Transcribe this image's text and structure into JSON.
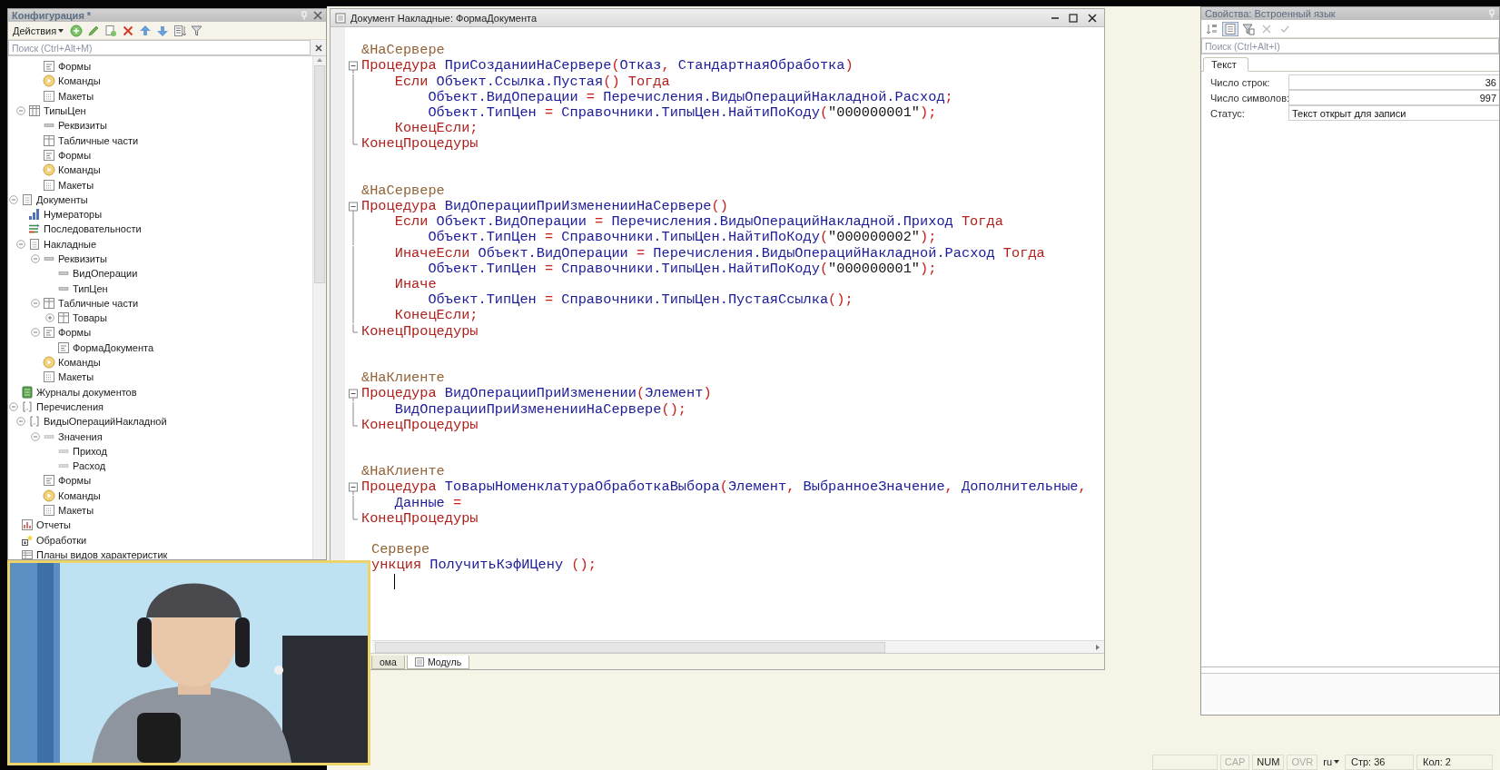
{
  "config_panel": {
    "title": "Конфигурация *",
    "actions": "Действия",
    "search": {
      "placeholder": "Поиск (Ctrl+Alt+M)"
    },
    "tree": [
      {
        "children": [
          {
            "children": [
              {
                "label": "Формы",
                "kind": "form"
              },
              {
                "label": "Команды",
                "kind": "command"
              },
              {
                "label": "Макеты",
                "kind": "layout"
              }
            ]
          },
          {
            "label": "ТипыЦен",
            "kind": "catalog",
            "expanded": true,
            "children": [
              {
                "label": "Реквизиты",
                "kind": "attribute"
              },
              {
                "label": "Табличные части",
                "kind": "tablepart"
              },
              {
                "label": "Формы",
                "kind": "form"
              },
              {
                "label": "Команды",
                "kind": "command"
              },
              {
                "label": "Макеты",
                "kind": "layout"
              }
            ]
          }
        ]
      },
      {
        "label": "Документы",
        "kind": "document",
        "expanded": true,
        "children": [
          {
            "label": "Нумераторы",
            "kind": "numerator"
          },
          {
            "label": "Последовательности",
            "kind": "sequence"
          },
          {
            "label": "Накладные",
            "kind": "document",
            "expanded": true,
            "children": [
              {
                "label": "Реквизиты",
                "kind": "attribute",
                "expanded": true,
                "children": [
                  {
                    "label": "ВидОперации",
                    "kind": "attribute"
                  },
                  {
                    "label": "ТипЦен",
                    "kind": "attribute"
                  }
                ]
              },
              {
                "label": "Табличные части",
                "kind": "tablepart",
                "expanded": true,
                "children": [
                  {
                    "label": "Товары",
                    "kind": "tablepart",
                    "expanded": false
                  }
                ]
              },
              {
                "label": "Формы",
                "kind": "form",
                "expanded": true,
                "children": [
                  {
                    "label": "ФормаДокумента",
                    "kind": "form"
                  }
                ]
              },
              {
                "label": "Команды",
                "kind": "command"
              },
              {
                "label": "Макеты",
                "kind": "layout"
              }
            ]
          }
        ]
      },
      {
        "label": "Журналы документов",
        "kind": "journal"
      },
      {
        "label": "Перечисления",
        "kind": "enum",
        "expanded": true,
        "children": [
          {
            "label": "ВидыОперацийНакладной",
            "kind": "enum",
            "expanded": true,
            "children": [
              {
                "label": "Значения",
                "kind": "value",
                "expanded": true,
                "children": [
                  {
                    "label": "Приход",
                    "kind": "value"
                  },
                  {
                    "label": "Расход",
                    "kind": "value"
                  }
                ]
              },
              {
                "label": "Формы",
                "kind": "form"
              },
              {
                "label": "Команды",
                "kind": "command"
              },
              {
                "label": "Макеты",
                "kind": "layout"
              }
            ]
          }
        ]
      },
      {
        "label": "Отчеты",
        "kind": "report"
      },
      {
        "label": "Обработки",
        "kind": "processing"
      },
      {
        "label": "Планы видов характеристик",
        "kind": "charplan"
      }
    ]
  },
  "editor": {
    "title": "Документ Накладные: ФормаДокумента",
    "lines": [
      {
        "kind": "blank"
      },
      {
        "kind": "plain",
        "tokens": [
          {
            "kind": "directive",
            "text": "&НаСервере"
          }
        ]
      },
      {
        "kind": "opener",
        "tokens": [
          {
            "kind": "keyword",
            "text": "Процедура"
          },
          {
            "kind": "name",
            "text": " ПриСозданииНаСервере"
          },
          {
            "kind": "punct",
            "text": "("
          },
          {
            "kind": "name",
            "text": "Отказ"
          },
          {
            "kind": "punct",
            "text": ","
          },
          {
            "kind": "name",
            "text": " СтандартнаяОбработка"
          },
          {
            "kind": "punct",
            "text": ")"
          }
        ]
      },
      {
        "kind": "inner",
        "tokens": [
          {
            "kind": "keyword",
            "text": "    Если"
          },
          {
            "kind": "name",
            "text": " Объект.Ссылка.Пустая"
          },
          {
            "kind": "punct",
            "text": "()"
          },
          {
            "kind": "keyword",
            "text": " Тогда"
          }
        ]
      },
      {
        "kind": "inner",
        "tokens": [
          {
            "kind": "name",
            "text": "        Объект.ВидОперации "
          },
          {
            "kind": "punct",
            "text": "="
          },
          {
            "kind": "name",
            "text": " Перечисления.ВидыОперацийНакладной.Расход"
          },
          {
            "kind": "punct",
            "text": ";"
          }
        ]
      },
      {
        "kind": "inner",
        "tokens": [
          {
            "kind": "name",
            "text": "        Объект.ТипЦен "
          },
          {
            "kind": "punct",
            "text": "="
          },
          {
            "kind": "name",
            "text": " Справочники.ТипыЦен.НайтиПоКоду"
          },
          {
            "kind": "punct",
            "text": "("
          },
          {
            "kind": "string",
            "text": "\"000000001\""
          },
          {
            "kind": "punct",
            "text": ");"
          }
        ]
      },
      {
        "kind": "inner",
        "tokens": [
          {
            "kind": "keyword",
            "text": "    КонецЕсли"
          },
          {
            "kind": "punct",
            "text": ";"
          }
        ]
      },
      {
        "kind": "closer",
        "tokens": [
          {
            "kind": "keyword",
            "text": "КонецПроцедуры"
          }
        ]
      },
      {
        "kind": "blank"
      },
      {
        "kind": "blank"
      },
      {
        "kind": "plain",
        "tokens": [
          {
            "kind": "directive",
            "text": "&НаСервере"
          }
        ]
      },
      {
        "kind": "opener",
        "tokens": [
          {
            "kind": "keyword",
            "text": "Процедура"
          },
          {
            "kind": "name",
            "text": " ВидОперацииПриИзмененииНаСервере"
          },
          {
            "kind": "punct",
            "text": "()"
          }
        ]
      },
      {
        "kind": "inner",
        "tokens": [
          {
            "kind": "keyword",
            "text": "    Если"
          },
          {
            "kind": "name",
            "text": " Объект.ВидОперации "
          },
          {
            "kind": "punct",
            "text": "="
          },
          {
            "kind": "name",
            "text": " Перечисления.ВидыОперацийНакладной.Приход"
          },
          {
            "kind": "keyword",
            "text": " Тогда"
          }
        ]
      },
      {
        "kind": "inner",
        "tokens": [
          {
            "kind": "name",
            "text": "        Объект.ТипЦен "
          },
          {
            "kind": "punct",
            "text": "="
          },
          {
            "kind": "name",
            "text": " Справочники.ТипыЦен.НайтиПоКоду"
          },
          {
            "kind": "punct",
            "text": "("
          },
          {
            "kind": "string",
            "text": "\"000000002\""
          },
          {
            "kind": "punct",
            "text": ");"
          }
        ]
      },
      {
        "kind": "inner",
        "tokens": [
          {
            "kind": "keyword",
            "text": "    ИначеЕсли"
          },
          {
            "kind": "name",
            "text": " Объект.ВидОперации "
          },
          {
            "kind": "punct",
            "text": "="
          },
          {
            "kind": "name",
            "text": " Перечисления.ВидыОперацийНакладной.Расход"
          },
          {
            "kind": "keyword",
            "text": " Тогда"
          }
        ]
      },
      {
        "kind": "inner",
        "tokens": [
          {
            "kind": "name",
            "text": "        Объект.ТипЦен "
          },
          {
            "kind": "punct",
            "text": "="
          },
          {
            "kind": "name",
            "text": " Справочники.ТипыЦен.НайтиПоКоду"
          },
          {
            "kind": "punct",
            "text": "("
          },
          {
            "kind": "string",
            "text": "\"000000001\""
          },
          {
            "kind": "punct",
            "text": ");"
          }
        ]
      },
      {
        "kind": "inner",
        "tokens": [
          {
            "kind": "keyword",
            "text": "    Иначе"
          }
        ]
      },
      {
        "kind": "inner",
        "tokens": [
          {
            "kind": "name",
            "text": "        Объект.ТипЦен "
          },
          {
            "kind": "punct",
            "text": "="
          },
          {
            "kind": "name",
            "text": " Справочники.ТипыЦен.ПустаяСсылка"
          },
          {
            "kind": "punct",
            "text": "();"
          }
        ]
      },
      {
        "kind": "inner",
        "tokens": [
          {
            "kind": "keyword",
            "text": "    КонецЕсли"
          },
          {
            "kind": "punct",
            "text": ";"
          }
        ]
      },
      {
        "kind": "closer",
        "tokens": [
          {
            "kind": "keyword",
            "text": "КонецПроцедуры"
          }
        ]
      },
      {
        "kind": "blank"
      },
      {
        "kind": "blank"
      },
      {
        "kind": "plain",
        "tokens": [
          {
            "kind": "directive",
            "text": "&НаКлиенте"
          }
        ]
      },
      {
        "kind": "opener",
        "tokens": [
          {
            "kind": "keyword",
            "text": "Процедура"
          },
          {
            "kind": "name",
            "text": " ВидОперацииПриИзменении"
          },
          {
            "kind": "punct",
            "text": "("
          },
          {
            "kind": "name",
            "text": "Элемент"
          },
          {
            "kind": "punct",
            "text": ")"
          }
        ]
      },
      {
        "kind": "inner",
        "tokens": [
          {
            "kind": "name",
            "text": "    ВидОперацииПриИзмененииНаСервере"
          },
          {
            "kind": "punct",
            "text": "();"
          }
        ]
      },
      {
        "kind": "closer",
        "tokens": [
          {
            "kind": "keyword",
            "text": "КонецПроцедуры"
          }
        ]
      },
      {
        "kind": "blank"
      },
      {
        "kind": "blank"
      },
      {
        "kind": "plain",
        "tokens": [
          {
            "kind": "directive",
            "text": "&НаКлиенте"
          }
        ]
      },
      {
        "kind": "opener",
        "tokens": [
          {
            "kind": "keyword",
            "text": "Процедура"
          },
          {
            "kind": "name",
            "text": " ТоварыНоменклатураОбработкаВыбора"
          },
          {
            "kind": "punct",
            "text": "("
          },
          {
            "kind": "name",
            "text": "Элемент"
          },
          {
            "kind": "punct",
            "text": ","
          },
          {
            "kind": "name",
            "text": " ВыбранноеЗначение"
          },
          {
            "kind": "punct",
            "text": ","
          },
          {
            "kind": "name",
            "text": " Дополнительные"
          },
          {
            "kind": "punct",
            "text": ","
          }
        ]
      },
      {
        "kind": "inner",
        "tokens": [
          {
            "kind": "name",
            "text": "    Данные "
          },
          {
            "kind": "punct",
            "text": "="
          }
        ]
      },
      {
        "kind": "closer",
        "tokens": [
          {
            "kind": "keyword",
            "text": "КонецПроцедуры"
          }
        ]
      },
      {
        "kind": "blank"
      },
      {
        "kind": "clipped",
        "tokens": [
          {
            "kind": "directive",
            "text": "Сервере"
          }
        ]
      },
      {
        "kind": "clipped",
        "tokens": [
          {
            "kind": "keyword",
            "text": "ункция"
          },
          {
            "kind": "name",
            "text": " ПолучитьКэфИЦену "
          },
          {
            "kind": "punct",
            "text": "();"
          }
        ]
      },
      {
        "kind": "cursor"
      }
    ],
    "tabs": [
      {
        "label": "ома",
        "selected": false
      },
      {
        "label": "Модуль",
        "selected": true
      }
    ]
  },
  "properties_panel": {
    "title": "Свойства: Встроенный язык",
    "tools": [
      {
        "kind": "sort",
        "selected": false,
        "disabled": false
      },
      {
        "kind": "grouping",
        "selected": true,
        "disabled": false
      },
      {
        "kind": "filter",
        "selected": false,
        "disabled": false
      },
      {
        "kind": "cancel",
        "selected": false,
        "disabled": true
      },
      {
        "kind": "apply",
        "selected": false,
        "disabled": true
      }
    ],
    "search": {
      "placeholder": "Поиск (Ctrl+Alt+I)"
    },
    "tabs": [
      {
        "label": "Текст",
        "selected": true
      }
    ],
    "rows": [
      {
        "label": "Число строк:",
        "value": "36",
        "kind": "number"
      },
      {
        "label": "Число символов:",
        "value": "997",
        "kind": "number"
      },
      {
        "label": "Статус:",
        "value": "Текст открыт для записи",
        "kind": "text"
      }
    ]
  },
  "status_bar": {
    "indicators": [
      {
        "label": "CAP",
        "on": false
      },
      {
        "label": "NUM",
        "on": true
      },
      {
        "label": "OVR",
        "on": false
      }
    ],
    "language": "ru",
    "fields": [
      "Стр: 36",
      "Кол: 2"
    ]
  }
}
